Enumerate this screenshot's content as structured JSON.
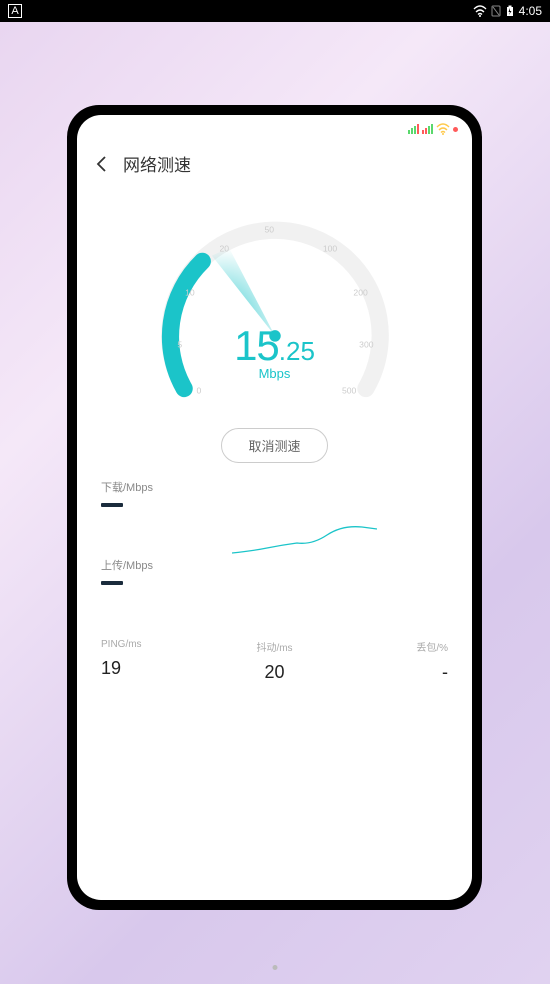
{
  "android_status": {
    "badge": "A",
    "time": "4:05"
  },
  "inner_status_colors": {
    "sig1": [
      "#5ad86c",
      "#5ad86c",
      "#5ad86c",
      "#ff5a5a"
    ],
    "sig2": [
      "#ff5a5a",
      "#ff5a5a",
      "#5ad86c",
      "#5ad86c"
    ],
    "wifi": "#ffc94a",
    "dot": "#ff5a5a"
  },
  "header": {
    "title": "网络测速"
  },
  "gauge": {
    "ticks": [
      "0",
      "5",
      "10",
      "20",
      "50",
      "100",
      "200",
      "300",
      "500"
    ],
    "speed_int": "15",
    "speed_dec": ".25",
    "unit": "Mbps"
  },
  "cancel_label": "取消测速",
  "download": {
    "label": "下载/Mbps"
  },
  "upload": {
    "label": "上传/Mbps"
  },
  "metrics": {
    "ping": {
      "label": "PING/ms",
      "value": "19"
    },
    "jitter": {
      "label": "抖动/ms",
      "value": "20"
    },
    "loss": {
      "label": "丢包/%",
      "value": "-"
    }
  },
  "chart_data": {
    "type": "gauge",
    "title": "网络测速",
    "ticks": [
      0,
      5,
      10,
      20,
      50,
      100,
      200,
      300,
      500
    ],
    "value": 15.25,
    "unit": "Mbps",
    "range_angle_deg": 270,
    "progress_fraction": 0.33,
    "ping_ms": 19,
    "jitter_ms": 20,
    "packet_loss_pct": null,
    "download_sparkline_approx": [
      2,
      3,
      4,
      5,
      8,
      7,
      10,
      12,
      15,
      14,
      18
    ]
  }
}
